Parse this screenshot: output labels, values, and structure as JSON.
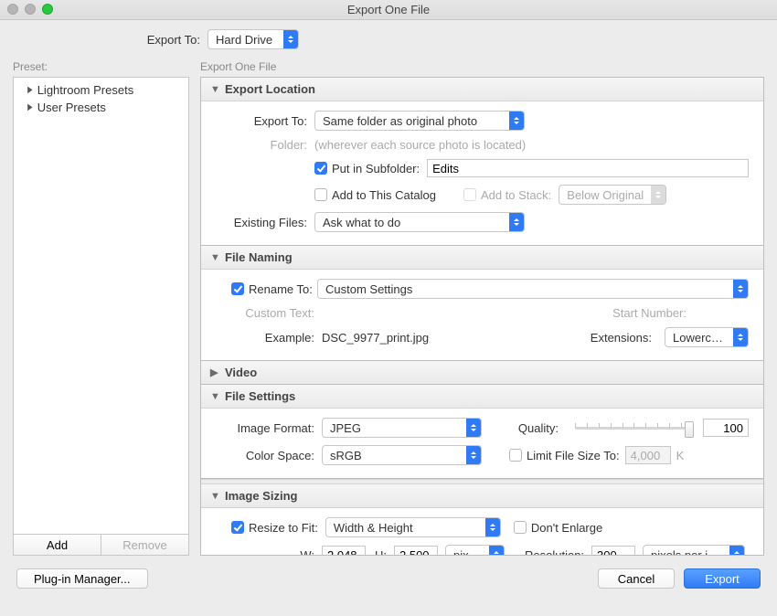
{
  "window_title": "Export One File",
  "export_to_label": "Export To:",
  "export_to_value": "Hard Drive",
  "preset": {
    "heading": "Preset:",
    "items": [
      "Lightroom Presets",
      "User Presets"
    ],
    "add_label": "Add",
    "remove_label": "Remove"
  },
  "main_heading": "Export One File",
  "sections": {
    "location": {
      "title": "Export Location",
      "export_to_label": "Export To:",
      "export_to_value": "Same folder as original photo",
      "folder_label": "Folder:",
      "folder_value": "(wherever each source photo is located)",
      "subfolder_label": "Put in Subfolder:",
      "subfolder_value": "Edits",
      "add_catalog_label": "Add to This Catalog",
      "add_stack_label": "Add to Stack:",
      "stack_position": "Below Original",
      "existing_label": "Existing Files:",
      "existing_value": "Ask what to do"
    },
    "naming": {
      "title": "File Naming",
      "rename_label": "Rename To:",
      "rename_value": "Custom Settings",
      "custom_text_label": "Custom Text:",
      "start_num_label": "Start Number:",
      "example_label": "Example:",
      "example_value": "DSC_9977_print.jpg",
      "extensions_label": "Extensions:",
      "extensions_value": "Lowercase"
    },
    "video": {
      "title": "Video"
    },
    "file_settings": {
      "title": "File Settings",
      "format_label": "Image Format:",
      "format_value": "JPEG",
      "quality_label": "Quality:",
      "quality_value": "100",
      "colorspace_label": "Color Space:",
      "colorspace_value": "sRGB",
      "limit_label": "Limit File Size To:",
      "limit_value": "4,000",
      "limit_unit": "K"
    },
    "sizing": {
      "title": "Image Sizing",
      "resize_label": "Resize to Fit:",
      "resize_value": "Width & Height",
      "dont_enlarge_label": "Don't Enlarge",
      "w_label": "W:",
      "w_value": "2,048",
      "h_label": "H:",
      "h_value": "2,500",
      "unit_value": "pixels",
      "resolution_label": "Resolution:",
      "resolution_value": "300",
      "resolution_unit": "pixels per inch"
    }
  },
  "footer": {
    "plugin_label": "Plug-in Manager...",
    "cancel_label": "Cancel",
    "export_label": "Export"
  }
}
